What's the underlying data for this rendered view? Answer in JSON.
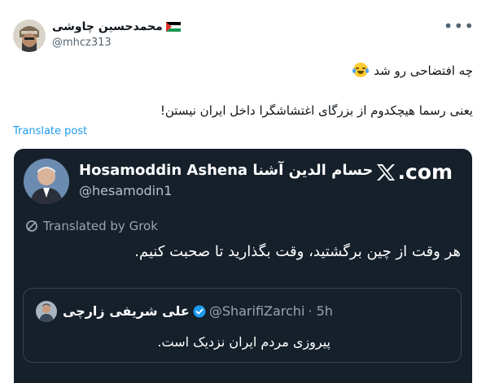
{
  "post": {
    "author_name": "محمدحسین چاوشی",
    "author_handle": "@mhcz313",
    "line1": "چه افتضاحی رو شد",
    "line2": "یعنی رسما هیچکدوم از بزرگای اغتشاشگرا داخل ایران نیستن!",
    "translate_label": "Translate post",
    "more_label": "•••"
  },
  "embed": {
    "author_name": "Hosamoddin Ashena حسام الدین آشنا",
    "author_handle": "@hesamodin1",
    "brand": ".com",
    "translated_by": "Translated by Grok",
    "text": "هر وقت از چین برگشتید، وقت بگذارید تا صحبت کنیم.",
    "quote": {
      "author_name": "علی شریفی زارچی",
      "author_handle": "@SharifiZarchi",
      "time": "· 5h",
      "text": "پیروزی مردم ایران نزدیک است."
    }
  },
  "colors": {
    "card_bg": "#15202b",
    "link": "#1d9bf0",
    "verified": "#1d9bf0"
  }
}
